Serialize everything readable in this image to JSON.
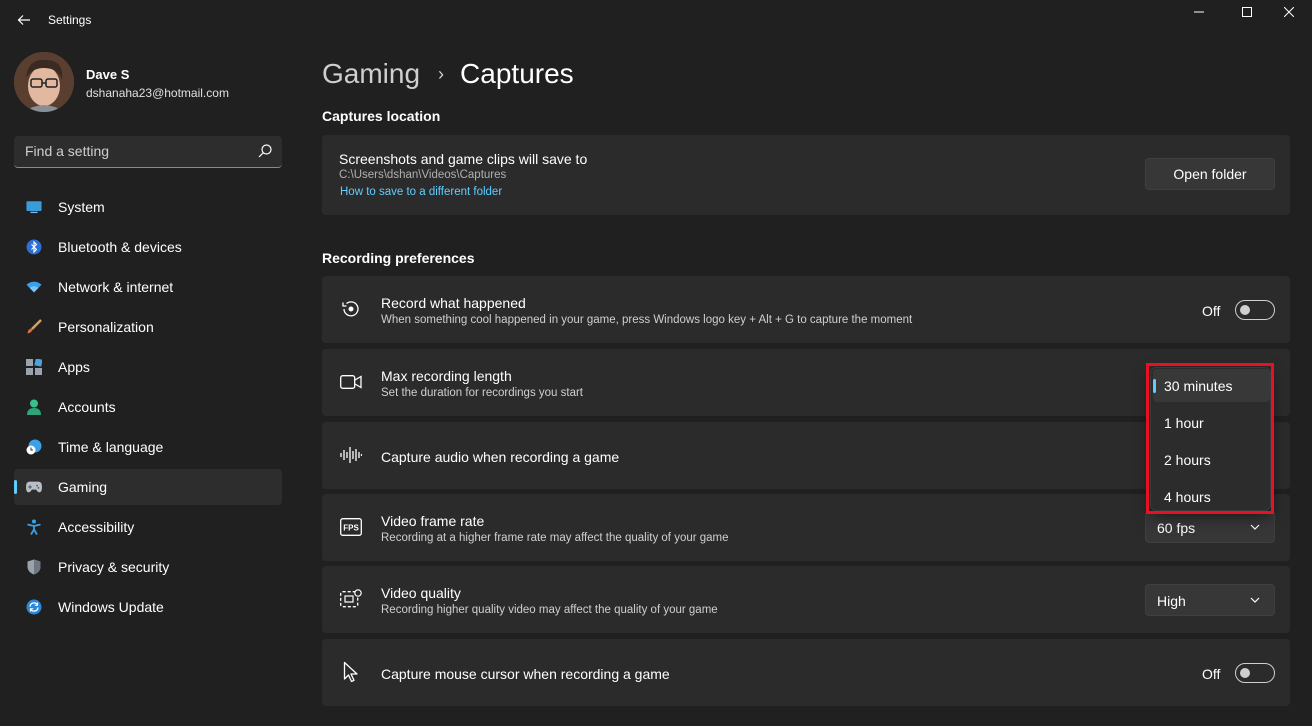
{
  "window": {
    "title": "Settings"
  },
  "user": {
    "name": "Dave S",
    "email": "dshanaha23@hotmail.com"
  },
  "search": {
    "placeholder": "Find a setting"
  },
  "sidebar": {
    "items": [
      {
        "label": "System",
        "icon": "system-icon",
        "active": false
      },
      {
        "label": "Bluetooth & devices",
        "icon": "bluetooth-icon",
        "active": false
      },
      {
        "label": "Network & internet",
        "icon": "wifi-icon",
        "active": false
      },
      {
        "label": "Personalization",
        "icon": "brush-icon",
        "active": false
      },
      {
        "label": "Apps",
        "icon": "apps-icon",
        "active": false
      },
      {
        "label": "Accounts",
        "icon": "accounts-icon",
        "active": false
      },
      {
        "label": "Time & language",
        "icon": "clock-globe-icon",
        "active": false
      },
      {
        "label": "Gaming",
        "icon": "gamepad-icon",
        "active": true
      },
      {
        "label": "Accessibility",
        "icon": "accessibility-icon",
        "active": false
      },
      {
        "label": "Privacy & security",
        "icon": "shield-icon",
        "active": false
      },
      {
        "label": "Windows Update",
        "icon": "update-icon",
        "active": false
      }
    ]
  },
  "breadcrumb": {
    "parent": "Gaming",
    "separator": "›",
    "current": "Captures"
  },
  "captures_location": {
    "section_title": "Captures location",
    "title": "Screenshots and game clips will save to",
    "path": "C:\\Users\\dshan\\Videos\\Captures",
    "link": "How to save to a different folder",
    "button": "Open folder"
  },
  "recording_preferences": {
    "section_title": "Recording preferences",
    "record_what_happened": {
      "title": "Record what happened",
      "desc": "When something cool happened in your game, press Windows logo key + Alt + G to capture the moment",
      "state": "Off"
    },
    "max_recording_length": {
      "title": "Max recording length",
      "desc": "Set the duration for recordings you start",
      "options": [
        "30 minutes",
        "1 hour",
        "2 hours",
        "4 hours"
      ],
      "selected": "30 minutes"
    },
    "capture_audio": {
      "title": "Capture audio when recording a game"
    },
    "video_frame_rate": {
      "title": "Video frame rate",
      "desc": "Recording at a higher frame rate may affect the quality of your game",
      "value": "60 fps"
    },
    "video_quality": {
      "title": "Video quality",
      "desc": "Recording higher quality video may affect the quality of your game",
      "value": "High"
    },
    "capture_mouse": {
      "title": "Capture mouse cursor when recording a game",
      "state": "Off"
    }
  },
  "colors": {
    "accent": "#60cdff",
    "highlight": "#e81123",
    "background": "#202020",
    "card": "#2b2b2b"
  }
}
